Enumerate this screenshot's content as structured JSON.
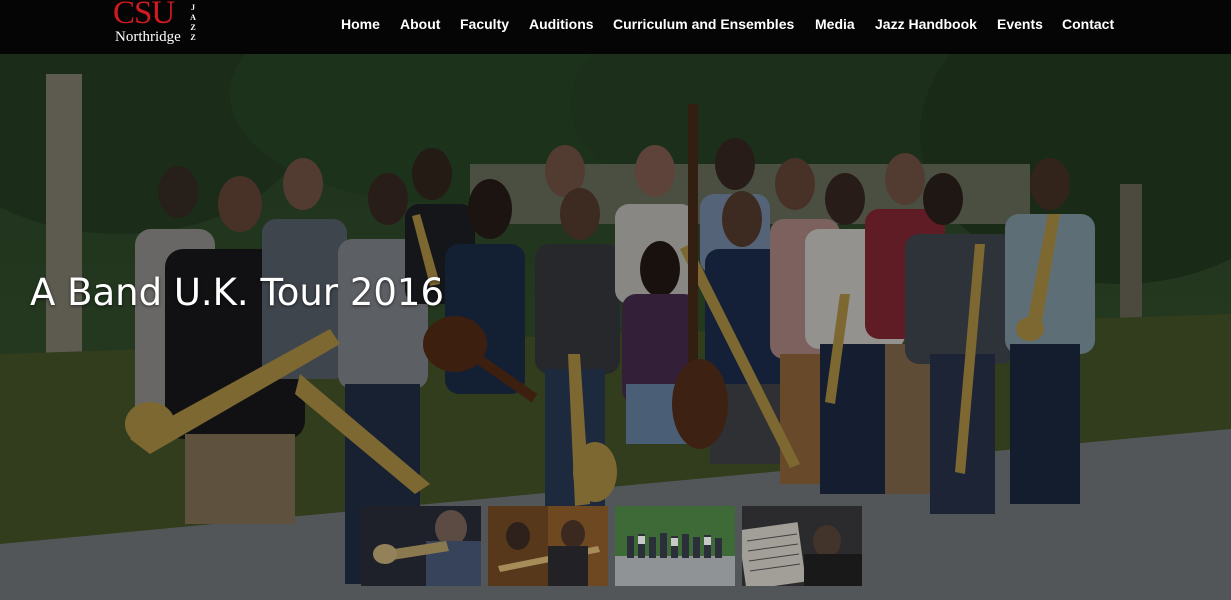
{
  "logo": {
    "main": "CSU",
    "sub": "Northridge",
    "side_letters": [
      "J",
      "A",
      "Z",
      "Z"
    ]
  },
  "nav": {
    "items": [
      "Home",
      "About",
      "Faculty",
      "Auditions",
      "Curriculum and Ensembles",
      "Media",
      "Jazz Handbook",
      "Events",
      "Contact"
    ]
  },
  "hero": {
    "caption": "A Band U.K. Tour 2016",
    "image": "jazz-band-group-photo"
  },
  "thumbnails": [
    {
      "image": "trumpet-player-photo"
    },
    {
      "image": "trombone-section-photo"
    },
    {
      "image": "group-photo"
    },
    {
      "image": "sheet-music-photo"
    }
  ],
  "colors": {
    "brand_red": "#d11a1f",
    "header_bg": "#050505",
    "nav_text": "#ffffff"
  }
}
